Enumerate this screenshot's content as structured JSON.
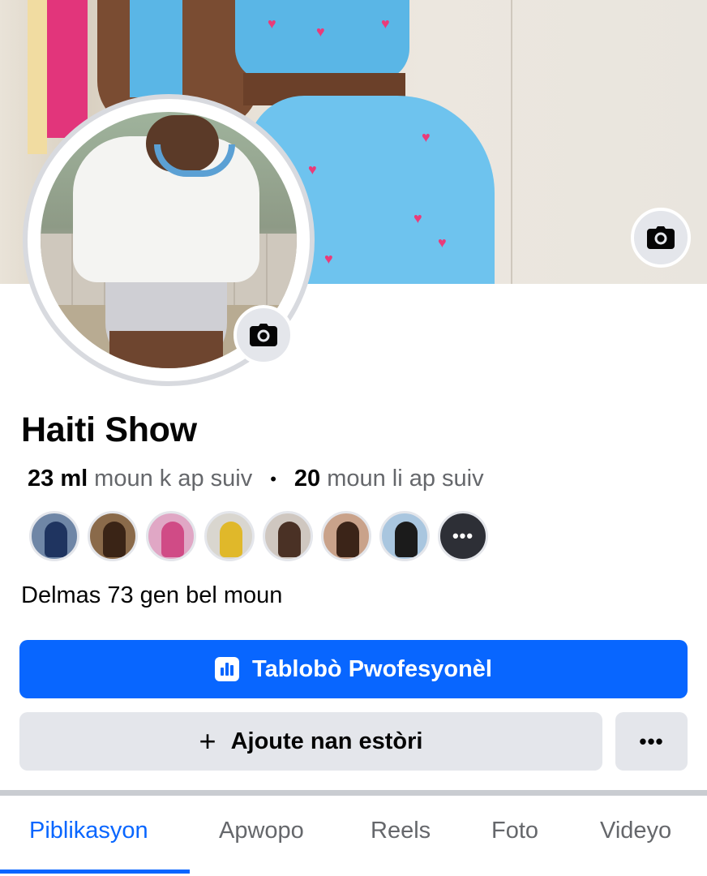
{
  "profile": {
    "name": "Haiti Show",
    "followers_count": "23 ml",
    "followers_label": "moun k ap suiv",
    "separator": "•",
    "following_count": "20",
    "following_label": "moun li ap suiv",
    "bio": "Delmas 73 gen bel moun"
  },
  "cover": {
    "camera_icon": "camera-icon"
  },
  "avatar": {
    "camera_icon": "camera-icon"
  },
  "friends_preview": {
    "count_shown": 8,
    "more_glyph": "•••"
  },
  "actions": {
    "dashboard_label": "Tablobò Pwofesyonèl",
    "dashboard_icon": "bar-chart-icon",
    "add_story_label": "Ajoute nan estòri",
    "add_story_icon": "plus-icon",
    "more_label": "•••"
  },
  "tabs": [
    {
      "label": "Piblikasyon",
      "active": true
    },
    {
      "label": "Apwopo",
      "active": false
    },
    {
      "label": "Reels",
      "active": false
    },
    {
      "label": "Foto",
      "active": false
    },
    {
      "label": "Videyo",
      "active": false
    }
  ],
  "colors": {
    "accent": "#0866ff",
    "secondary_button": "#e4e6eb",
    "muted_text": "#65676b"
  }
}
